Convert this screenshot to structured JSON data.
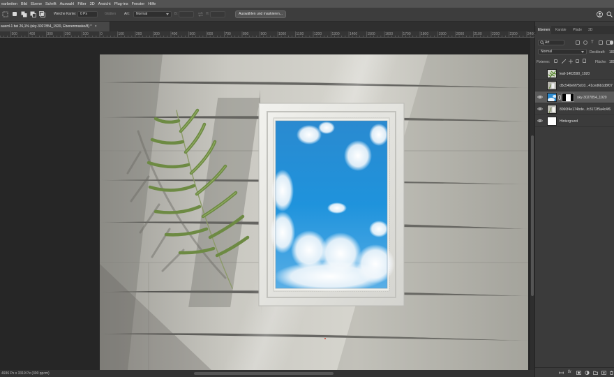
{
  "menubar": {
    "items": [
      "earbeiten",
      "Bild",
      "Ebene",
      "Schrift",
      "Auswahl",
      "Filter",
      "3D",
      "Ansicht",
      "Plug-ins",
      "Fenster",
      "Hilfe"
    ]
  },
  "options": {
    "feather_label": "Weiche Kante:",
    "feather_value": "0 Px",
    "smooth_label": "Glätten",
    "style_label": "Art:",
    "style_value": "Normal",
    "width_label": "B:",
    "height_label": "H:",
    "select_mask_button": "Auswählen und maskieren..."
  },
  "document": {
    "tab_title": "auerd-1 bei 26,1% (sky-3027854_1920, Ebenenmaske/8) *",
    "close_glyph": "×"
  },
  "ruler": {
    "labels": [
      "1000",
      "900",
      "800",
      "700",
      "600",
      "500",
      "400",
      "300",
      "200",
      "100",
      "0",
      "100",
      "200",
      "300",
      "400",
      "500",
      "600",
      "700",
      "800",
      "900",
      "1000",
      "1100",
      "1200",
      "1300",
      "1400",
      "1500",
      "1600",
      "1700",
      "1800",
      "1900",
      "2000",
      "2100",
      "2200",
      "2300",
      "2400",
      "2500",
      "2600",
      "2700",
      "2800",
      "2900",
      "3000",
      "3100",
      "3200",
      "3300",
      "3400",
      "3500",
      "3600",
      "3700",
      "3800",
      "3900",
      "4000",
      "4100",
      "4200",
      "4300",
      "4400",
      "4500",
      "4600",
      "4700"
    ]
  },
  "status": {
    "text": "4936 Px x 3319 Px (300 ppcm)"
  },
  "panel": {
    "tabs": [
      "Ebenen",
      "Kanäle",
      "Pfade",
      "3D"
    ],
    "kind_label": "Art",
    "blend_mode": "Normal",
    "opacity_label": "Deckkraft:",
    "opacity_value": "100",
    "lock_label": "Fixieren:",
    "fill_label": "Fläche:",
    "fill_value": "100",
    "layers": [
      {
        "name": "leaf-1402590_1920",
        "visible": false,
        "selected": false,
        "has_mask": false,
        "thumb": "leaf"
      },
      {
        "name": "d5c540e6f75d10...41ced6b1d8f07",
        "visible": false,
        "selected": false,
        "has_mask": false,
        "thumb": "photo"
      },
      {
        "name": "sky-3027854_1920",
        "visible": true,
        "selected": true,
        "has_mask": true,
        "thumb": "sky"
      },
      {
        "name": "8060f4e174bde...fc3172f5a4c4f6",
        "visible": true,
        "selected": false,
        "has_mask": false,
        "thumb": "photo"
      },
      {
        "name": "Hintergrund",
        "visible": true,
        "selected": false,
        "has_mask": false,
        "thumb": "white"
      }
    ]
  },
  "colors": {
    "menubar": "#535353",
    "panel": "#3b3b3b",
    "sky": "#1f8fd6",
    "selected_layer": "#5a5a5a"
  }
}
